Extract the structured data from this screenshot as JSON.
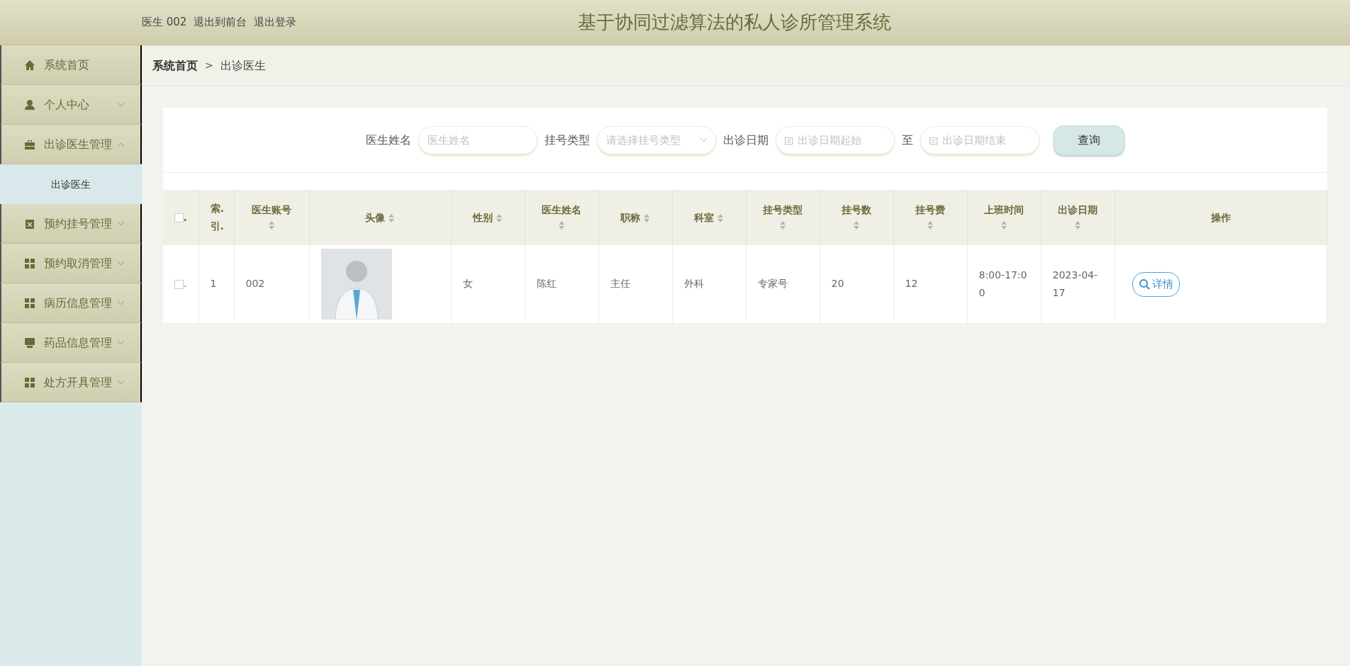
{
  "header": {
    "user": "医生 002",
    "links": [
      "退出到前台",
      "退出登录"
    ],
    "title": "基于协同过滤算法的私人诊所管理系统"
  },
  "sidebar": {
    "items": [
      {
        "label": "系统首页",
        "kind": "link"
      },
      {
        "label": "个人中心",
        "kind": "group",
        "expanded": false
      },
      {
        "label": "出诊医生管理",
        "kind": "group",
        "expanded": true,
        "children": [
          {
            "label": "出诊医生",
            "selected": true
          }
        ]
      },
      {
        "label": "预约挂号管理",
        "kind": "group",
        "expanded": false
      },
      {
        "label": "预约取消管理",
        "kind": "group",
        "expanded": false
      },
      {
        "label": "病历信息管理",
        "kind": "group",
        "expanded": false
      },
      {
        "label": "药品信息管理",
        "kind": "group",
        "expanded": false
      },
      {
        "label": "处方开具管理",
        "kind": "group",
        "expanded": false
      }
    ]
  },
  "breadcrumb": {
    "items": [
      "系统首页",
      "出诊医生"
    ],
    "separator": ">"
  },
  "search": {
    "fields": [
      {
        "label": "医生姓名",
        "kind": "text",
        "placeholder": "医生姓名"
      },
      {
        "label": "挂号类型",
        "kind": "select",
        "placeholder": "请选择挂号类型"
      },
      {
        "label": "出诊日期",
        "kind": "date",
        "placeholder": "出诊日期起始"
      },
      {
        "label": "至",
        "kind": "date",
        "placeholder": "出诊日期结束"
      }
    ],
    "button": "查询"
  },
  "table": {
    "checkbox_label": ".",
    "header_checked": false,
    "columns": [
      {
        "label": "索.引.",
        "sortable": false
      },
      {
        "label": "医生账号",
        "sortable": true
      },
      {
        "label": "头像",
        "sortable": true
      },
      {
        "label": "性别",
        "sortable": true
      },
      {
        "label": "医生姓名",
        "sortable": true
      },
      {
        "label": "职称",
        "sortable": true
      },
      {
        "label": "科室",
        "sortable": true
      },
      {
        "label": "挂号类型",
        "sortable": true
      },
      {
        "label": "挂号数",
        "sortable": true
      },
      {
        "label": "挂号费",
        "sortable": true
      },
      {
        "label": "上班时间",
        "sortable": true
      },
      {
        "label": "出诊日期",
        "sortable": true
      },
      {
        "label": "操作",
        "sortable": false
      }
    ],
    "rows": [
      {
        "checked": false,
        "cells": [
          "1",
          "002",
          null,
          "女",
          "陈红",
          "主任",
          "外科",
          "专家号",
          "20",
          "12",
          "8:00-17:00",
          "2023-04-17"
        ],
        "action": "详情"
      }
    ]
  }
}
